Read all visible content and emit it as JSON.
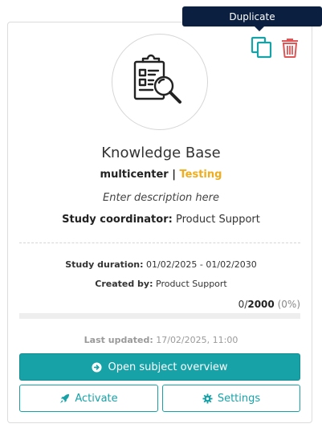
{
  "tooltip": {
    "text": "Duplicate"
  },
  "actions": {
    "duplicate_icon": "copy-icon",
    "delete_icon": "trash-icon"
  },
  "study": {
    "title": "Knowledge Base",
    "type": "multicenter",
    "separator": " | ",
    "status": "Testing",
    "description": "Enter description here",
    "coordinator_label": "Study coordinator:",
    "coordinator_value": "Product Support"
  },
  "meta": {
    "duration_label": "Study duration:",
    "duration_value": "01/02/2025 - 01/02/2030",
    "created_label": "Created by:",
    "created_value": "Product Support"
  },
  "enrollment": {
    "current": "0",
    "separator": "/",
    "total": "2000",
    "percent": "(0%)",
    "progress_fraction": 0
  },
  "updated": {
    "label": "Last updated:",
    "value": "17/02/2025, 11:00"
  },
  "buttons": {
    "open_label": "Open subject overview",
    "activate_label": "Activate",
    "settings_label": "Settings"
  },
  "colors": {
    "accent": "#17a2a8",
    "status": "#f0ad1e",
    "danger": "#e05555",
    "tooltip_bg": "#0b2040"
  }
}
